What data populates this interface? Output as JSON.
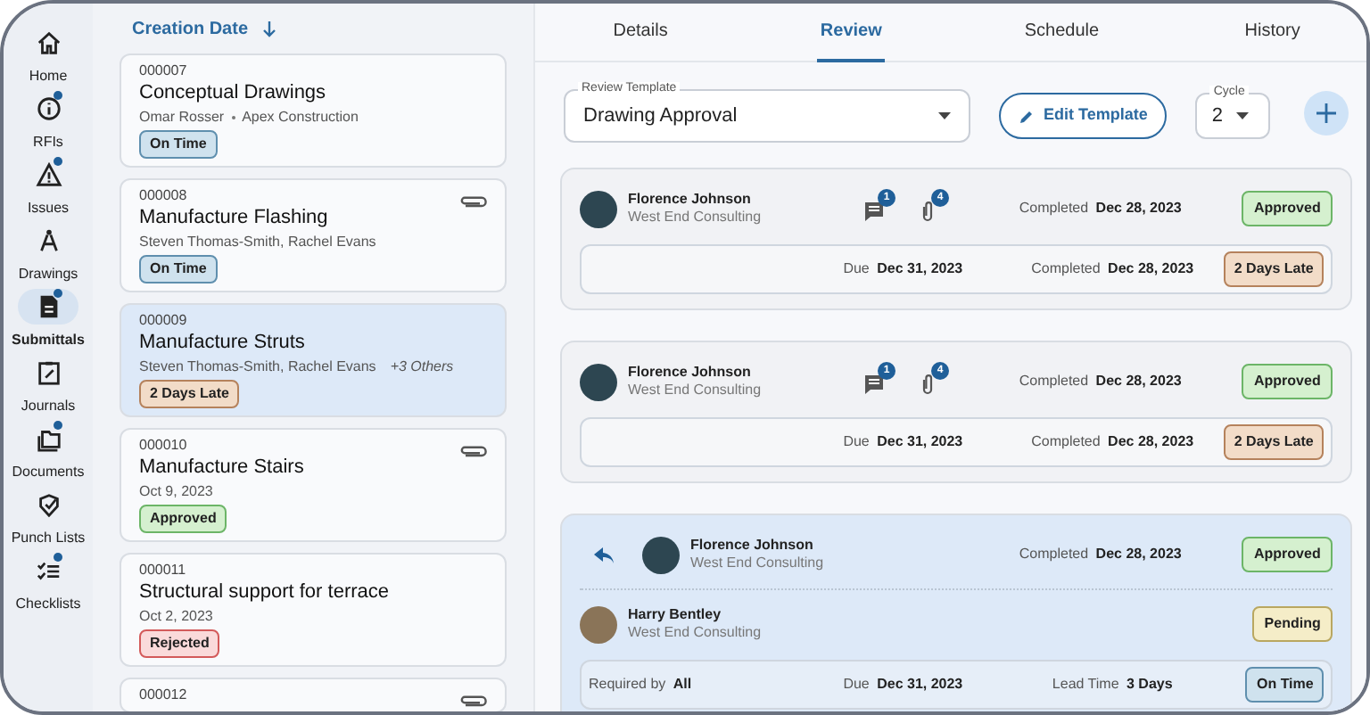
{
  "nav": [
    {
      "label": "Home",
      "dot": false,
      "selected": false
    },
    {
      "label": "RFIs",
      "dot": true,
      "selected": false
    },
    {
      "label": "Issues",
      "dot": true,
      "selected": false
    },
    {
      "label": "Drawings",
      "dot": false,
      "selected": false
    },
    {
      "label": "Submittals",
      "dot": true,
      "selected": true
    },
    {
      "label": "Journals",
      "dot": false,
      "selected": false
    },
    {
      "label": "Documents",
      "dot": true,
      "selected": false
    },
    {
      "label": "Punch Lists",
      "dot": false,
      "selected": false
    },
    {
      "label": "Checklists",
      "dot": true,
      "selected": false
    }
  ],
  "sort": {
    "label": "Creation Date"
  },
  "submittals": [
    {
      "id": "000007",
      "title": "Conceptual Drawings",
      "meta": [
        "Omar Rosser",
        "Apex Construction"
      ],
      "status": {
        "label": "On Time",
        "kind": "on_time"
      },
      "attachment": false,
      "selected": false
    },
    {
      "id": "000008",
      "title": "Manufacture Flashing",
      "meta": [
        "Steven Thomas-Smith, Rachel Evans"
      ],
      "status": {
        "label": "On Time",
        "kind": "on_time"
      },
      "attachment": true,
      "selected": false
    },
    {
      "id": "000009",
      "title": "Manufacture Struts",
      "meta": [
        "Steven Thomas-Smith, Rachel Evans"
      ],
      "extra": "+3 Others",
      "status": {
        "label": "2 Days Late",
        "kind": "late"
      },
      "attachment": false,
      "selected": true
    },
    {
      "id": "000010",
      "title": "Manufacture Stairs",
      "meta": [
        "Oct 9, 2023"
      ],
      "status": {
        "label": "Approved",
        "kind": "approved"
      },
      "attachment": true,
      "selected": false
    },
    {
      "id": "000011",
      "title": "Structural support for terrace",
      "meta": [
        "Oct 2, 2023"
      ],
      "status": {
        "label": "Rejected",
        "kind": "rejected"
      },
      "attachment": false,
      "selected": false
    },
    {
      "id": "000012",
      "attachment": true,
      "selected": false
    }
  ],
  "tabs": [
    {
      "label": "Details",
      "selected": false
    },
    {
      "label": "Review",
      "selected": true
    },
    {
      "label": "Schedule",
      "selected": false
    },
    {
      "label": "History",
      "selected": false
    }
  ],
  "template_field": {
    "label": "Review Template",
    "value": "Drawing Approval"
  },
  "edit_button": {
    "label": "Edit Template"
  },
  "cycle_field": {
    "label": "Cycle",
    "value": "2"
  },
  "reviews": [
    {
      "selected": false,
      "reviewers": [
        {
          "name": "Florence Johnson",
          "company": "West End Consulting",
          "comments": "1",
          "attachments": "4",
          "completed_label": "Completed",
          "completed": "Dec 28, 2023",
          "status": {
            "label": "Approved",
            "kind": "approved"
          },
          "reply": false
        }
      ],
      "footer": [
        {
          "label": "Due",
          "value": "Dec 31, 2023"
        },
        {
          "label": "Completed",
          "value": "Dec 28, 2023"
        }
      ],
      "footer_status": {
        "label": "2 Days Late",
        "kind": "late"
      }
    },
    {
      "selected": false,
      "reviewers": [
        {
          "name": "Florence Johnson",
          "company": "West End Consulting",
          "comments": "1",
          "attachments": "4",
          "completed_label": "Completed",
          "completed": "Dec 28, 2023",
          "status": {
            "label": "Approved",
            "kind": "approved"
          },
          "reply": false
        }
      ],
      "footer": [
        {
          "label": "Due",
          "value": "Dec 31, 2023"
        },
        {
          "label": "Completed",
          "value": "Dec 28, 2023"
        }
      ],
      "footer_status": {
        "label": "2 Days Late",
        "kind": "late"
      }
    },
    {
      "selected": true,
      "reviewers": [
        {
          "name": "Florence Johnson",
          "company": "West End Consulting",
          "completed_label": "Completed",
          "completed": "Dec 28, 2023",
          "status": {
            "label": "Approved",
            "kind": "approved"
          },
          "reply": true
        },
        {
          "name": "Harry Bentley",
          "company": "West End Consulting",
          "status": {
            "label": "Pending",
            "kind": "pending"
          },
          "reply": false
        }
      ],
      "footer": [
        {
          "label": "Required by",
          "value": "All"
        },
        {
          "label": "Due",
          "value": "Dec 31, 2023"
        },
        {
          "label": "Lead Time",
          "value": "3 Days"
        }
      ],
      "footer_status": {
        "label": "On Time",
        "kind": "on_time"
      }
    }
  ]
}
